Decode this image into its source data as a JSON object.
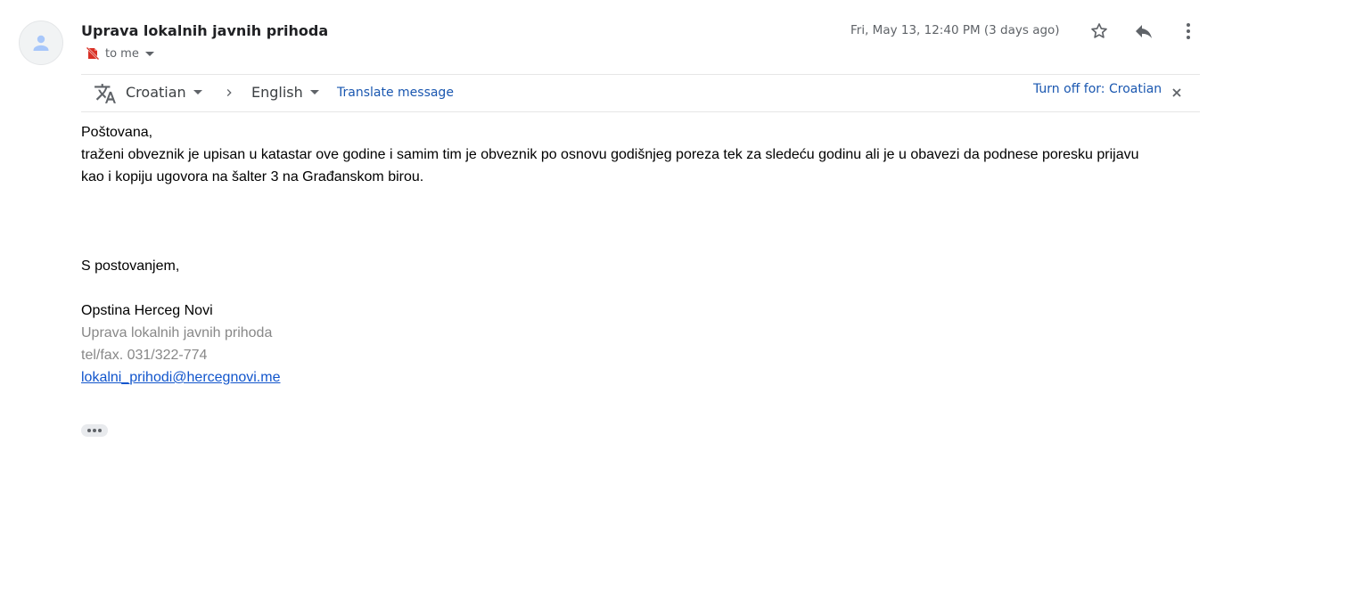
{
  "email": {
    "sender_name": "Uprava lokalnih javnih prihoda",
    "recipient_label": "to me",
    "date": "Fri, May 13, 12:40 PM (3 days ago)"
  },
  "translate_bar": {
    "source_language": "Croatian",
    "target_language": "English",
    "translate_link": "Translate message",
    "turn_off_link": "Turn off for: Croatian"
  },
  "body": {
    "greeting": "Poštovana,",
    "line1": "traženi obveznik je upisan u katastar ove godine i samim tim je obveznik po osnovu godišnjeg poreza tek za sledeću godinu ali je u obavezi da podnese poresku prijavu",
    "line2": "kao i kopiju ugovora na šalter 3 na Građanskom birou.",
    "closing": "S postovanjem,"
  },
  "signature": {
    "org": "Opstina Herceg Novi",
    "dept": "Uprava lokalnih javnih prihoda",
    "phone": "tel/fax. 031/322-774",
    "email": "lokalni_prihodi@hercegnovi.me"
  },
  "icons": {
    "avatar": "person-icon",
    "warning": "unverified-sender-icon",
    "star": "star-icon",
    "reply": "reply-icon",
    "more": "more-vert-icon",
    "translate": "translate-icon",
    "separator": "chevron-right-icon",
    "close": "close-icon"
  },
  "colors": {
    "link": "#1a57b0",
    "signature_gray": "#888888",
    "warning_red": "#d93025"
  }
}
